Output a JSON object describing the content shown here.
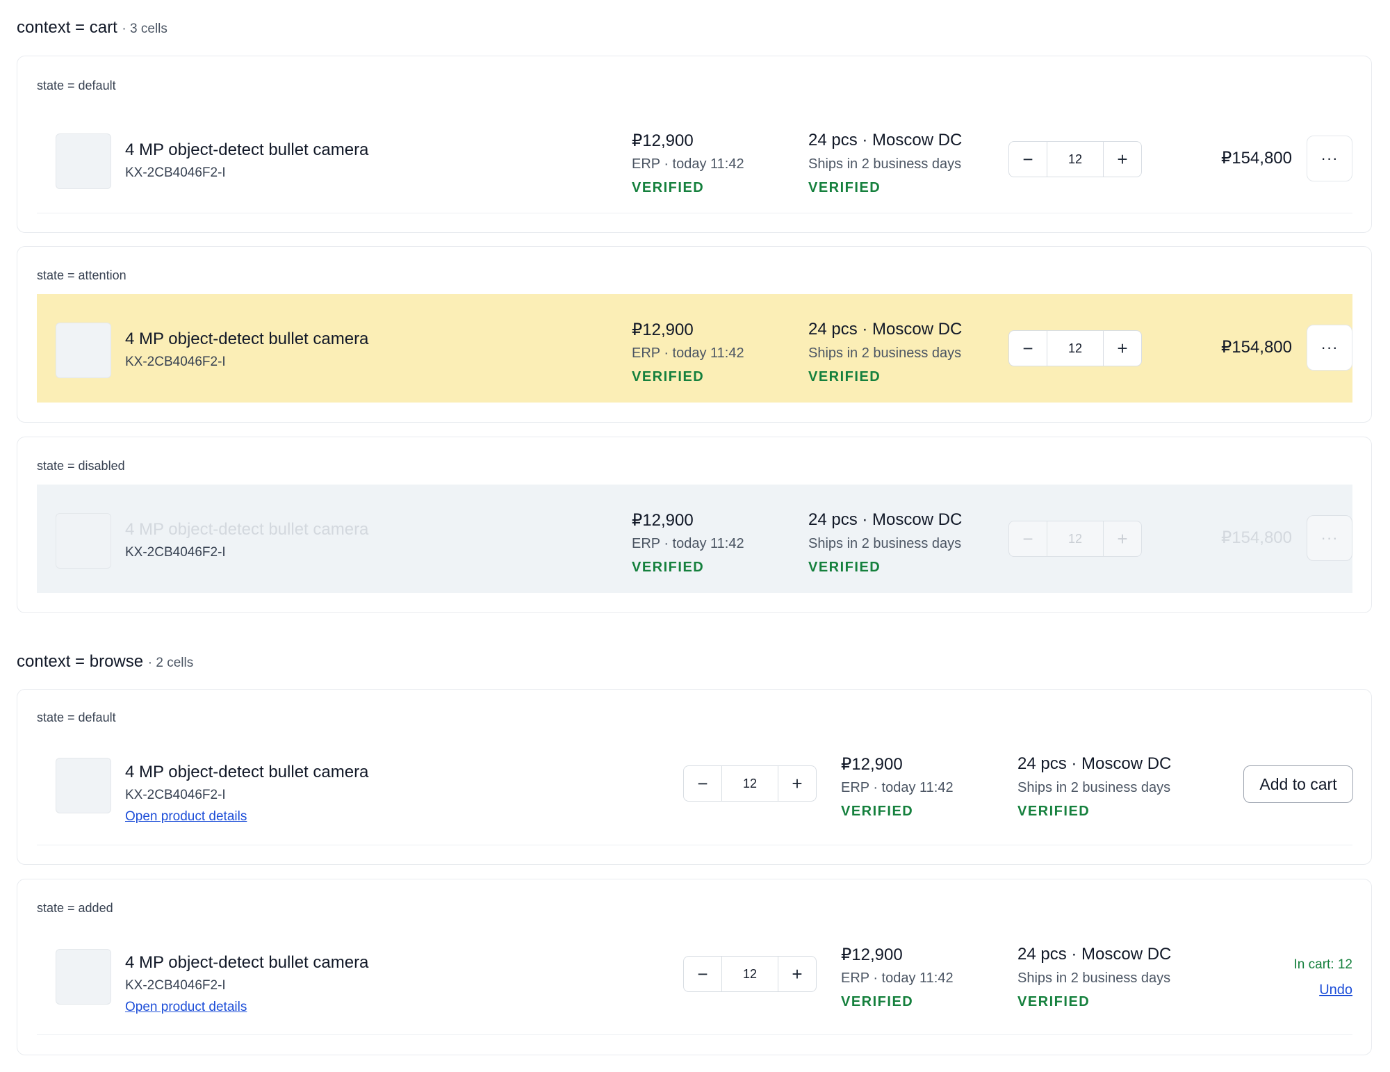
{
  "sections": [
    {
      "context_label": "context = cart",
      "count_label": "· 3 cells",
      "cells": [
        {
          "state_label": "state = default"
        },
        {
          "state_label": "state = attention"
        },
        {
          "state_label": "state = disabled"
        }
      ]
    },
    {
      "context_label": "context = browse",
      "count_label": "· 2 cells",
      "cells": [
        {
          "state_label": "state = default"
        },
        {
          "state_label": "state = added"
        }
      ]
    }
  ],
  "product": {
    "name": "4 MP object-detect bullet camera",
    "sku": "KX-2CB4046F2-I",
    "details_link": "Open product details",
    "price": "₽12,900",
    "price_source": "ERP · today 11:42",
    "price_status": "VERIFIED",
    "stock": "24 pcs · Moscow DC",
    "shipping": "Ships in 2 business days",
    "stock_status": "VERIFIED",
    "quantity": "12",
    "line_total": "₽154,800"
  },
  "controls": {
    "minus": "−",
    "plus": "+",
    "more": "···",
    "add_to_cart": "Add to cart",
    "in_cart": "In cart: 12",
    "undo": "Undo"
  },
  "colors": {
    "attention_bg": "#fbeeb6",
    "disabled_bg": "#eff3f6",
    "verified": "#15803d",
    "link": "#1d4ed8"
  }
}
